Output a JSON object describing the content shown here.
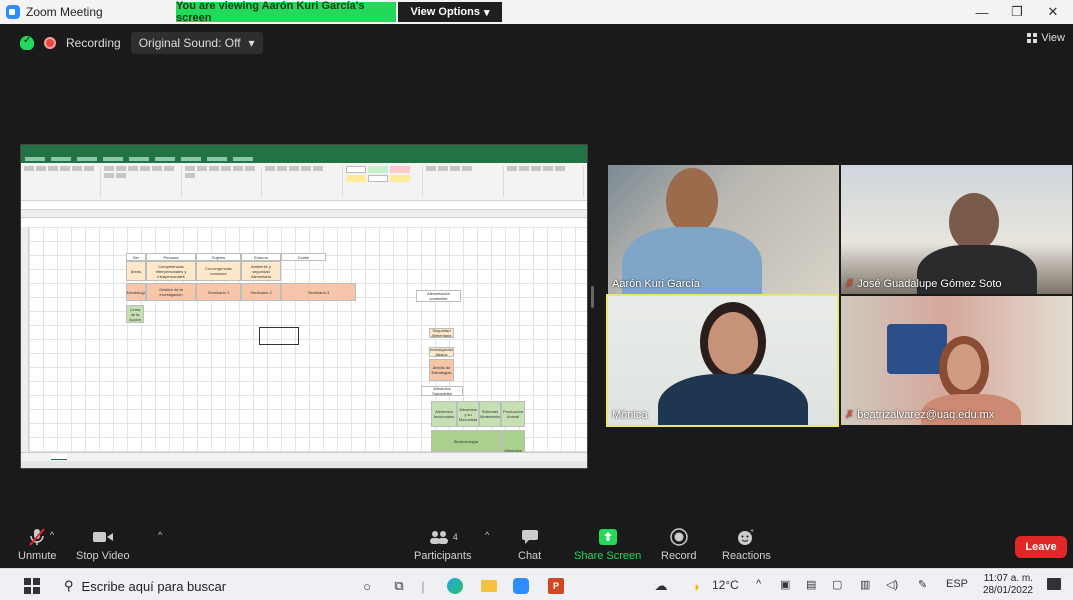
{
  "window": {
    "title": "Zoom Meeting",
    "share_banner": "You are viewing Aarón Kuri García's screen",
    "view_options": "View Options",
    "minimize": "—",
    "maximize": "❐",
    "close": "✕"
  },
  "status": {
    "recording": "Recording",
    "original_sound": "Original Sound: Off",
    "original_sound_caret": "▾",
    "view": "View"
  },
  "spreadsheet": {
    "cells": [
      {
        "id": "h1",
        "text": "Ser",
        "color": "#ffffff"
      },
      {
        "id": "h2",
        "text": "Persona",
        "color": "#ffffff"
      },
      {
        "id": "h3",
        "text": "Sujetos",
        "color": "#ffffff"
      },
      {
        "id": "h4",
        "text": "Entorno",
        "color": "#ffffff"
      },
      {
        "id": "h5",
        "text": "Contin",
        "color": "#ffffff"
      },
      {
        "id": "r1a",
        "text": "Áreas",
        "color": "#fde9c9"
      },
      {
        "id": "r1b",
        "text": "Competencias Interpersonales y Intrapersonales",
        "color": "#fde9c9"
      },
      {
        "id": "r1c",
        "text": "Convergencias comunes",
        "color": "#fde9c9"
      },
      {
        "id": "r1d",
        "text": "Ambiente y seguridad Alimentaria",
        "color": "#fde9c9"
      },
      {
        "id": "r2a",
        "text": "Metodología",
        "color": "#f7c5a7"
      },
      {
        "id": "r2b",
        "text": "Gestión de la investigación",
        "color": "#f7c5a7"
      },
      {
        "id": "r2c",
        "text": "Seminario 1",
        "color": "#f7c5a7"
      },
      {
        "id": "r2d",
        "text": "Seminario 2",
        "color": "#f7c5a7"
      },
      {
        "id": "r2e",
        "text": "Seminario 3",
        "color": "#f7c5a7"
      },
      {
        "id": "r3a",
        "text": "Línea de la Acción",
        "color": "#c6e0b4"
      },
      {
        "id": "s1",
        "text": "Alimentación sostenible",
        "color": "#ffffff"
      },
      {
        "id": "s2",
        "text": "Seguridad Alimentaria",
        "color": "#fde9c9"
      },
      {
        "id": "s3",
        "text": "Investigación Básica",
        "color": "#fde9c9"
      },
      {
        "id": "s4",
        "text": "Ámbito de Estrategias",
        "color": "#f7c5a7"
      },
      {
        "id": "s5",
        "text": "Alimentos Saludables",
        "color": "#ffffff"
      },
      {
        "id": "g1",
        "text": "Alimentos funcionales",
        "color": "#c6e0b4"
      },
      {
        "id": "g2",
        "text": "Alimentos y su Microbiota",
        "color": "#c6e0b4"
      },
      {
        "id": "g3",
        "text": "Sistemas Alimentarios",
        "color": "#c6e0b4"
      },
      {
        "id": "g4",
        "text": "Producción Animal",
        "color": "#c6e0b4"
      },
      {
        "id": "g5",
        "text": "Biotecnología",
        "color": "#a9d08e"
      },
      {
        "id": "g6",
        "text": "Alimentos",
        "color": "#a9d08e"
      }
    ]
  },
  "participants": [
    {
      "id": "p1",
      "name": "Aarón Kuri García",
      "muted": false
    },
    {
      "id": "p2",
      "name": "José Guadalupe Gómez Soto",
      "muted": true
    },
    {
      "id": "p3",
      "name": "Mónica",
      "muted": false
    },
    {
      "id": "p4",
      "name": "beatrizalvarez@uaq.edu.mx",
      "muted": true
    }
  ],
  "toolbar": {
    "unmute": "Unmute",
    "stop_video": "Stop Video",
    "participants": "Participants",
    "participants_count": "4",
    "chat": "Chat",
    "share_screen": "Share Screen",
    "record": "Record",
    "reactions": "Reactions",
    "leave": "Leave",
    "caret": "^"
  },
  "taskbar": {
    "search_placeholder": "Escribe aquí para buscar",
    "temperature": "12°C",
    "language": "ESP",
    "time": "11:07 a. m.",
    "date": "28/01/2022"
  },
  "colors": {
    "zoom_blue": "#2d8cff",
    "banner_green": "#23d959",
    "leave_red": "#e02828",
    "active_speaker": "#e8e86b",
    "excel_green": "#217346"
  }
}
